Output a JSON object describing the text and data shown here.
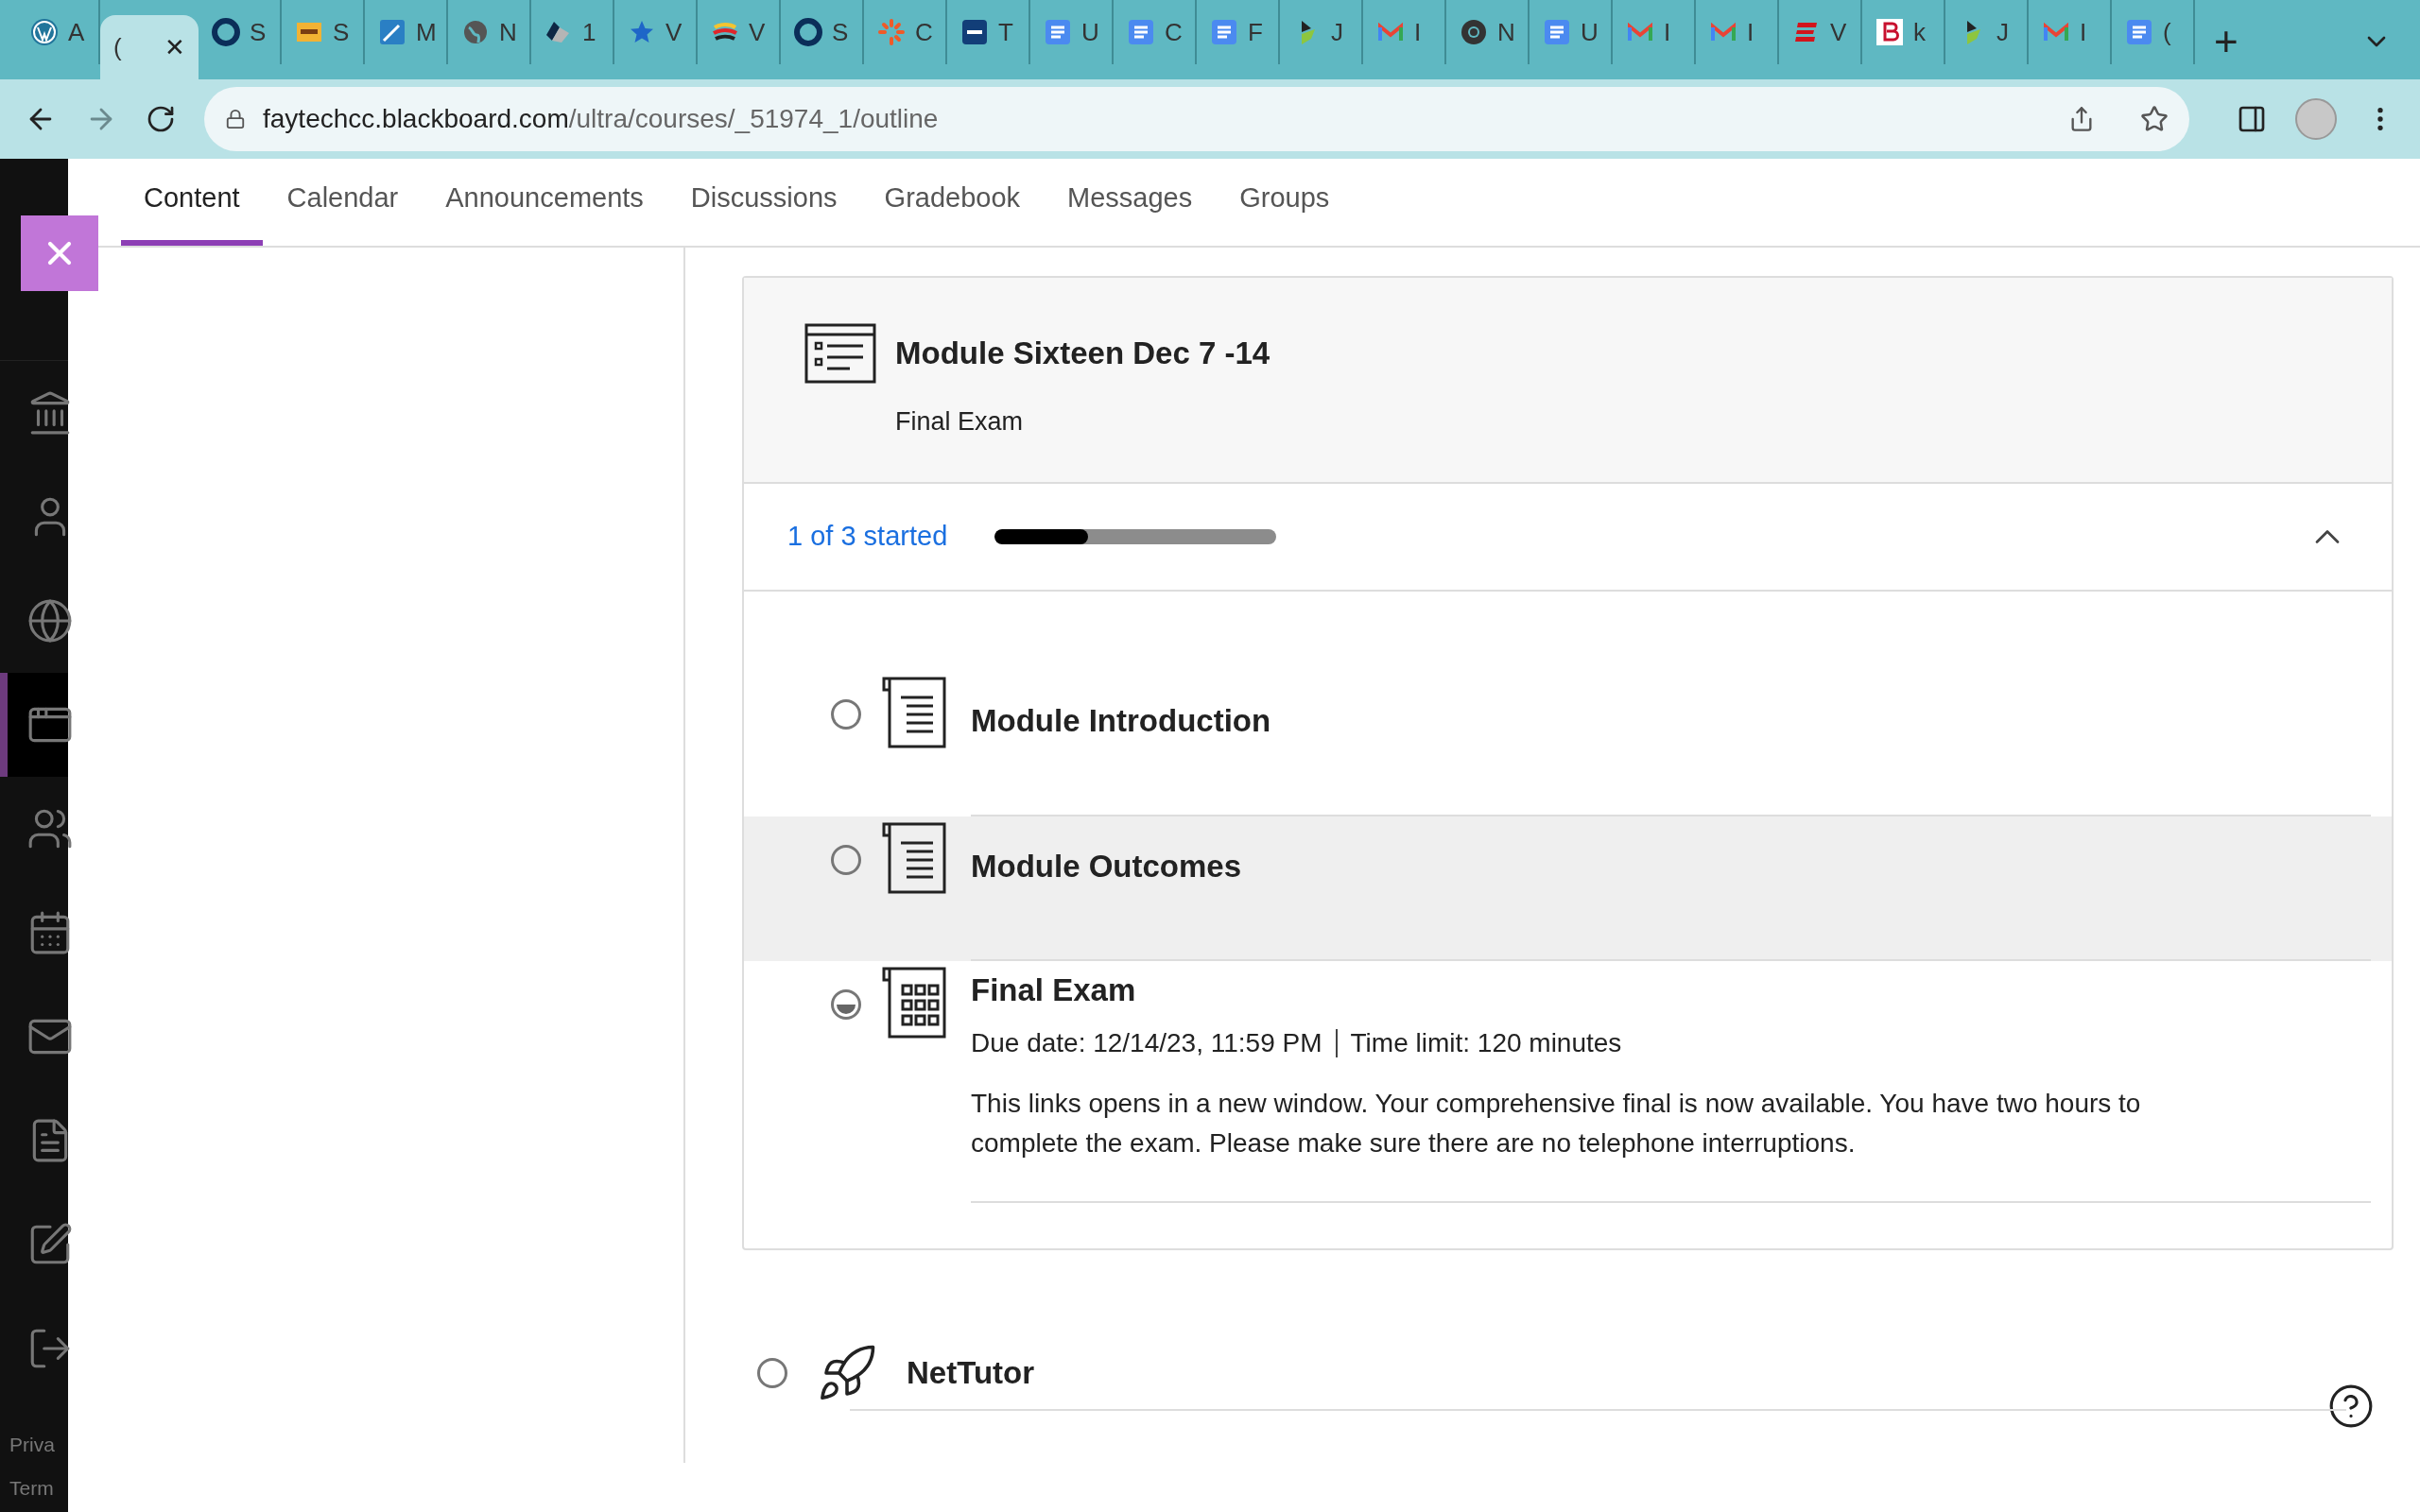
{
  "browser": {
    "tabs": [
      {
        "label": "A",
        "selected": false
      },
      {
        "label": "(",
        "selected": true,
        "close": "✕"
      },
      {
        "label": "S",
        "selected": false
      },
      {
        "label": "S",
        "selected": false
      },
      {
        "label": "M",
        "selected": false
      },
      {
        "label": "N",
        "selected": false
      },
      {
        "label": "1",
        "selected": false
      },
      {
        "label": "V",
        "selected": false
      },
      {
        "label": "V",
        "selected": false
      },
      {
        "label": "S",
        "selected": false
      },
      {
        "label": "C",
        "selected": false
      },
      {
        "label": "T",
        "selected": false
      },
      {
        "label": "U",
        "selected": false
      },
      {
        "label": "C",
        "selected": false
      },
      {
        "label": "F",
        "selected": false
      },
      {
        "label": "J",
        "selected": false
      },
      {
        "label": "I",
        "selected": false
      },
      {
        "label": "N",
        "selected": false
      },
      {
        "label": "U",
        "selected": false
      },
      {
        "label": "I",
        "selected": false
      },
      {
        "label": "I",
        "selected": false
      },
      {
        "label": "V",
        "selected": false
      },
      {
        "label": "k",
        "selected": false
      },
      {
        "label": "J",
        "selected": false
      },
      {
        "label": "I",
        "selected": false
      },
      {
        "label": "(",
        "selected": false
      }
    ],
    "new_tab": "+",
    "url_host": "faytechcc.blackboard.com",
    "url_path": "/ultra/courses/_51974_1/outline"
  },
  "course_nav": [
    {
      "label": "Content",
      "selected": true
    },
    {
      "label": "Calendar",
      "selected": false
    },
    {
      "label": "Announcements",
      "selected": false
    },
    {
      "label": "Discussions",
      "selected": false
    },
    {
      "label": "Gradebook",
      "selected": false
    },
    {
      "label": "Messages",
      "selected": false
    },
    {
      "label": "Groups",
      "selected": false
    }
  ],
  "sidebar": {
    "items": [
      {
        "selected": false
      },
      {
        "selected": false
      },
      {
        "selected": false
      },
      {
        "selected": true
      },
      {
        "selected": false
      },
      {
        "selected": false
      },
      {
        "selected": false
      },
      {
        "selected": false
      },
      {
        "selected": false
      },
      {
        "selected": false
      }
    ],
    "footer": [
      "Priva",
      "Term"
    ]
  },
  "module": {
    "title": "Module Sixteen Dec 7 -14",
    "subtitle": "Final Exam",
    "progress_text": "1 of 3 started",
    "level": 0.33,
    "expanded": true,
    "items": [
      {
        "kind": "document",
        "title": "Module Introduction",
        "started": false,
        "selected": false
      },
      {
        "kind": "document",
        "title": "Module Outcomes",
        "started": false,
        "selected": true
      },
      {
        "kind": "test",
        "title": "Final Exam",
        "started": true,
        "selected": false,
        "due": "Due date: 12/14/23, 11:59 PM",
        "time_limit": "Time limit: 120 minutes",
        "description": "This links opens in a new window. Your comprehensive final is now available. You have two hours to complete the exam. Please make sure there are no telephone interruptions."
      }
    ]
  },
  "next_item": {
    "title": "NetTutor",
    "started": false
  }
}
